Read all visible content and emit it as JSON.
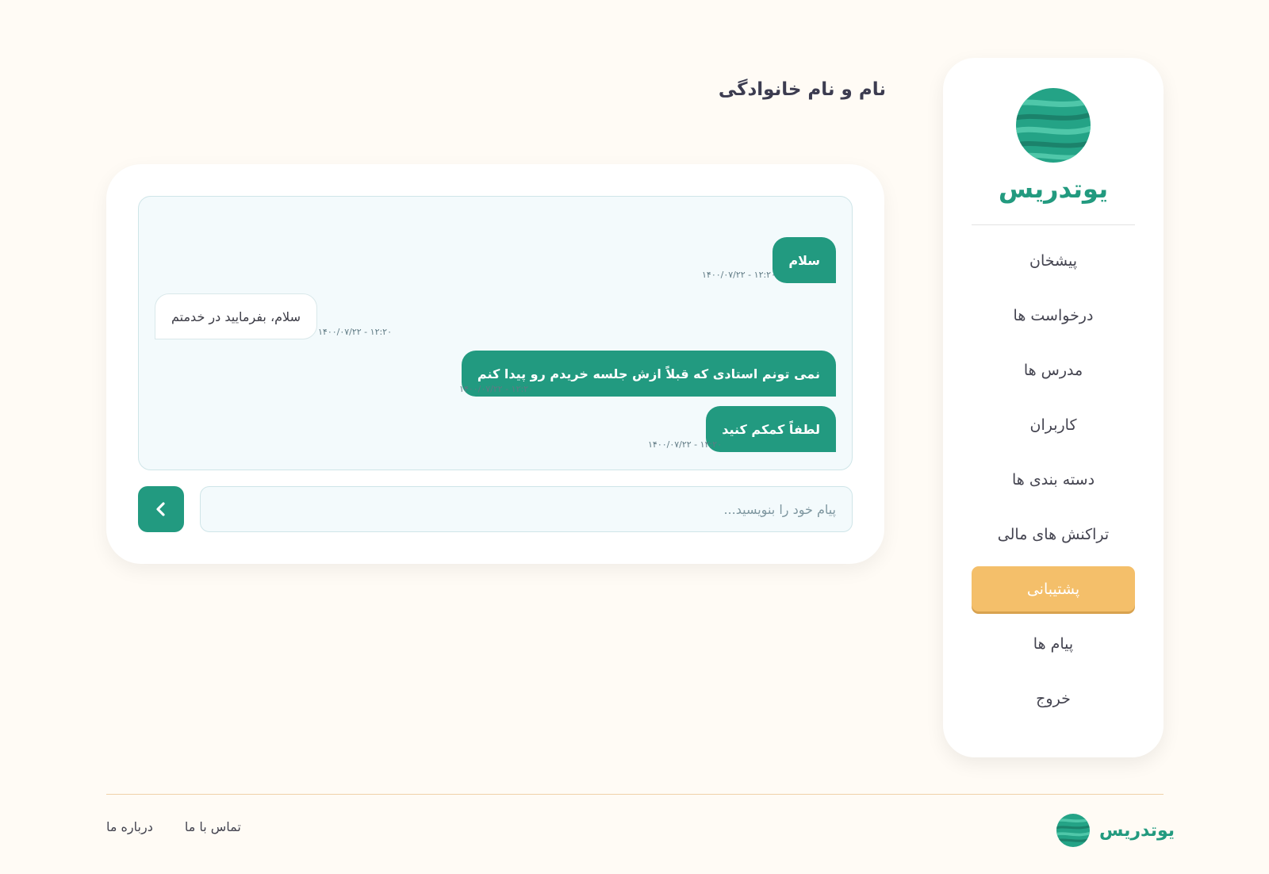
{
  "sidebar": {
    "brand": "یوتدریس",
    "items": [
      {
        "label": "پیشخان",
        "active": false
      },
      {
        "label": "درخواست ها",
        "active": false
      },
      {
        "label": "مدرس ها",
        "active": false
      },
      {
        "label": "کاربران",
        "active": false
      },
      {
        "label": "دسته بندی ها",
        "active": false
      },
      {
        "label": "تراکنش های مالی",
        "active": false
      },
      {
        "label": "پشتیبانی",
        "active": true
      },
      {
        "label": "پیام ها",
        "active": false
      },
      {
        "label": "خروج",
        "active": false
      }
    ]
  },
  "header": {
    "title": "نام و نام خانوادگی"
  },
  "chat": {
    "messages": [
      {
        "text": "سلام",
        "time": "۱۲:۲۰ - ۱۴۰۰/۰۷/۲۲",
        "direction": "out"
      },
      {
        "text": "سلام، بفرمایید در خدمتم",
        "time": "۱۲:۲۰ - ۱۴۰۰/۰۷/۲۲",
        "direction": "in"
      },
      {
        "text": "نمی تونم استادی که قبلاً ازش جلسه خریدم رو پیدا کنم",
        "time": "۱۲:۲۰ - ۱۴۰۰/۰۷/۲۲",
        "direction": "out"
      },
      {
        "text": "لطفاً کمکم کنید",
        "time": "۱۲:۲۰ - ۱۴۰۰/۰۷/۲۲",
        "direction": "out"
      }
    ],
    "input_placeholder": "پیام خود را بنویسید...",
    "input_value": "",
    "send_icon": "chevron-left-icon"
  },
  "footer": {
    "brand": "یوتدریس",
    "links": [
      "درباره ما",
      "تماس با ما"
    ]
  },
  "colors": {
    "accent": "#229a80",
    "active_nav": "#f4bf6a",
    "page_background": "#fffbf5"
  }
}
